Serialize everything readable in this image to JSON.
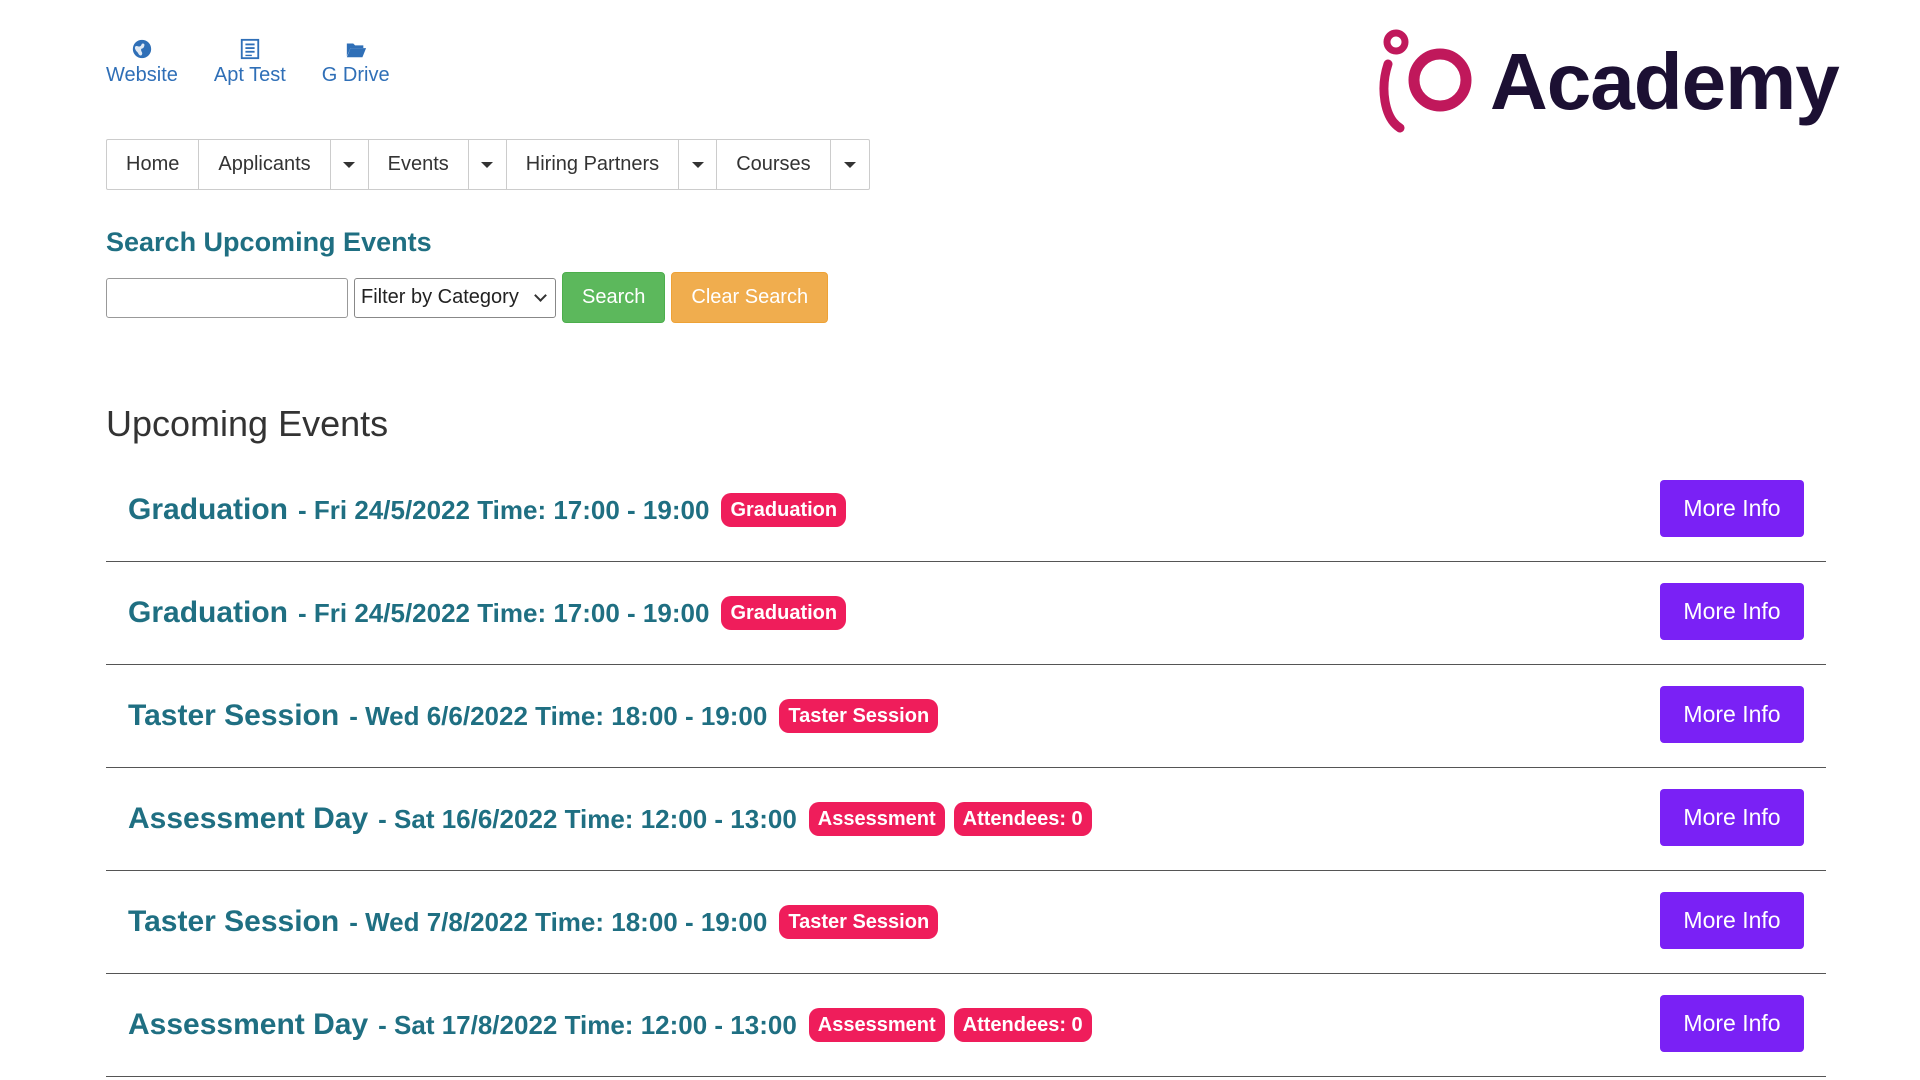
{
  "quick_links": [
    {
      "label": "Website",
      "icon": "globe-icon"
    },
    {
      "label": "Apt Test",
      "icon": "list-document-icon"
    },
    {
      "label": "G Drive",
      "icon": "folder-open-icon"
    }
  ],
  "logo": {
    "text": "Academy",
    "mark_text": "iO",
    "brand_color": "#c0185b",
    "text_color": "#1c1033"
  },
  "nav": [
    {
      "label": "Home",
      "dropdown": false
    },
    {
      "label": "Applicants",
      "dropdown": true
    },
    {
      "label": "Events",
      "dropdown": true
    },
    {
      "label": "Hiring Partners",
      "dropdown": true
    },
    {
      "label": "Courses",
      "dropdown": true
    }
  ],
  "search": {
    "title": "Search Upcoming Events",
    "input_value": "",
    "input_placeholder": "",
    "filter_selected": "Filter by Category",
    "search_label": "Search",
    "clear_label": "Clear Search"
  },
  "events": {
    "title": "Upcoming Events",
    "more_info_label": "More Info",
    "items": [
      {
        "name": "Graduation",
        "details": "- Fri 24/5/2022 Time: 17:00 - 19:00",
        "badges": [
          "Graduation"
        ]
      },
      {
        "name": "Graduation",
        "details": "- Fri 24/5/2022 Time: 17:00 - 19:00",
        "badges": [
          "Graduation"
        ]
      },
      {
        "name": "Taster Session",
        "details": "- Wed 6/6/2022 Time: 18:00 - 19:00",
        "badges": [
          "Taster Session"
        ]
      },
      {
        "name": "Assessment Day",
        "details": "- Sat 16/6/2022 Time: 12:00 - 13:00",
        "badges": [
          "Assessment",
          "Attendees: 0"
        ]
      },
      {
        "name": "Taster Session",
        "details": "- Wed 7/8/2022 Time: 18:00 - 19:00",
        "badges": [
          "Taster Session"
        ]
      },
      {
        "name": "Assessment Day",
        "details": "- Sat 17/8/2022 Time: 12:00 - 13:00",
        "badges": [
          "Assessment",
          "Attendees: 0"
        ]
      }
    ]
  },
  "colors": {
    "link": "#2f6fb7",
    "heading_teal": "#1f6f82",
    "badge": "#ef1d5b",
    "more_info": "#7a21f5",
    "search_btn": "#5cb85c",
    "clear_btn": "#f0ad4e"
  }
}
